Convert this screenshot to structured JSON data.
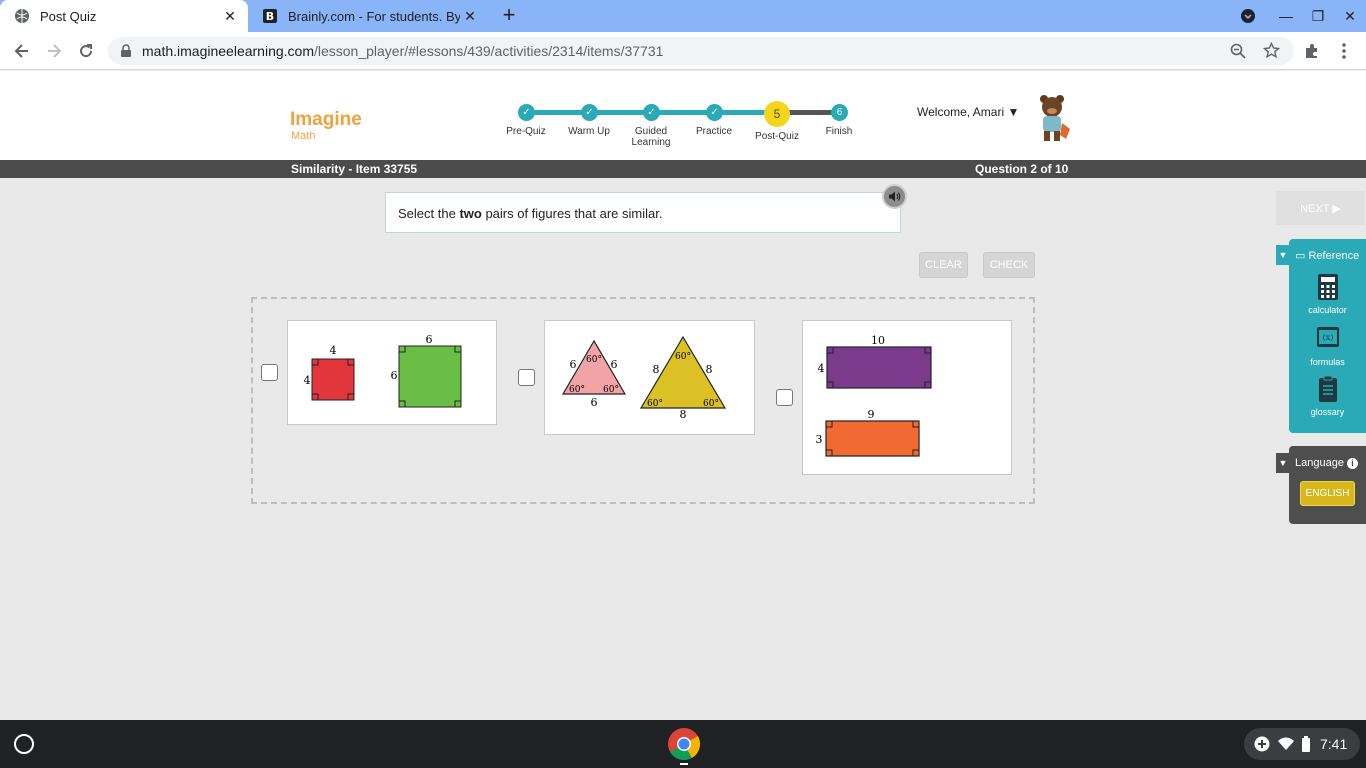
{
  "browser": {
    "tabs": [
      {
        "title": "Post Quiz",
        "icon": "globe-icon",
        "active": true
      },
      {
        "title": "Brainly.com - For students. By st",
        "icon": "brainly-icon",
        "active": false
      }
    ],
    "url_host": "math.imagineelearning.com",
    "url_path": "/lesson_player/#lessons/439/activities/2314/items/37731"
  },
  "app": {
    "logo_name": "Imagine",
    "logo_sub": "Math",
    "steps": [
      {
        "label": "Pre-Quiz",
        "state": "done",
        "num": ""
      },
      {
        "label": "Warm Up",
        "state": "done",
        "num": ""
      },
      {
        "label": "Guided Learning",
        "state": "done",
        "num": ""
      },
      {
        "label": "Practice",
        "state": "done",
        "num": ""
      },
      {
        "label": "Post-Quiz",
        "state": "current",
        "num": "5"
      },
      {
        "label": "Finish",
        "state": "todo",
        "num": "6"
      }
    ],
    "welcome": "Welcome, Amari"
  },
  "titlebar": {
    "item_title": "Similarity - Item 33755",
    "question_count": "Question 2 of 10"
  },
  "prompt": {
    "before": "Select the ",
    "bold": "two",
    "after": " pairs of figures that are similar."
  },
  "buttons": {
    "clear": "CLEAR",
    "check": "CHECK",
    "next": "NEXT ▶"
  },
  "figures": {
    "squares": {
      "small_side": "4",
      "large_side": "6"
    },
    "triangles": {
      "small_side": "6",
      "large_side": "8",
      "angle": "60°"
    },
    "rectangles": {
      "top_w": "10",
      "top_h": "4",
      "bottom_w": "9",
      "bottom_h": "3"
    },
    "colors": {
      "red": "#e2363d",
      "green": "#6abd45",
      "pink": "#f2a3a6",
      "yellow": "#dbc125",
      "purple": "#7b3a8b",
      "orange": "#f06a32"
    }
  },
  "reference": {
    "title": "Reference",
    "items": [
      {
        "label": "calculator",
        "icon": "calculator-icon"
      },
      {
        "label": "formulas",
        "icon": "formulas-icon"
      },
      {
        "label": "glossary",
        "icon": "glossary-icon"
      }
    ]
  },
  "language": {
    "title": "Language",
    "button": "ENGLISH"
  },
  "taskbar": {
    "clock": "7:41"
  }
}
